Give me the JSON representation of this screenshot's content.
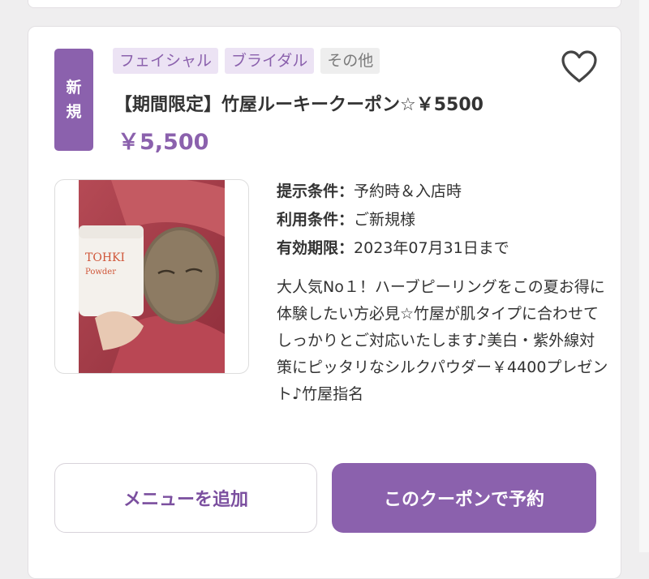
{
  "badge": {
    "line1": "新",
    "line2": "規"
  },
  "tags": [
    {
      "label": "フェイシャル",
      "style": "purple"
    },
    {
      "label": "ブライダル",
      "style": "purple"
    },
    {
      "label": "その他",
      "style": "gray"
    }
  ],
  "favorite": {
    "icon": "heart-outline-icon"
  },
  "coupon": {
    "title": "【期間限定】竹屋ルーキークーポン☆￥5500",
    "price": "￥5,500"
  },
  "image": {
    "product_text_1": "TOHKI",
    "product_text_2": "Powder"
  },
  "conditions": [
    {
      "label": "提示条件：",
      "value": "予約時＆入店時"
    },
    {
      "label": "利用条件：",
      "value": "ご新規様"
    },
    {
      "label": "有効期限：",
      "value": "2023年07月31日まで"
    }
  ],
  "description": "大人気No１！ハーブピーリングをこの夏お得に体験したい方必見☆竹屋が肌タイプに合わせてしっかりとご対応いたします♪美白・紫外線対策にピッタリなシルクパウダー￥4400プレゼント♪竹屋指名",
  "buttons": {
    "add_menu": "メニューを追加",
    "book": "このクーポンで予約"
  },
  "colors": {
    "accent": "#8b61ad",
    "tag_bg": "#ece3f4",
    "card_bg": "#ffffff",
    "page_bg": "#efeeef"
  }
}
